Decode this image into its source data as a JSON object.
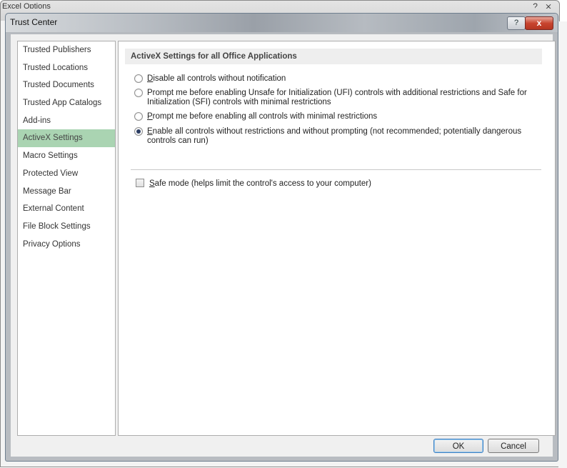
{
  "background_window": {
    "title": "Excel Options",
    "help_glyph": "?",
    "close_glyph": "⨯"
  },
  "dialog": {
    "title": "Trust Center",
    "help_glyph": "?",
    "close_glyph": "x"
  },
  "nav": {
    "items": [
      {
        "label": "Trusted Publishers"
      },
      {
        "label": "Trusted Locations"
      },
      {
        "label": "Trusted Documents"
      },
      {
        "label": "Trusted App Catalogs"
      },
      {
        "label": "Add-ins"
      },
      {
        "label": "ActiveX Settings",
        "active": true
      },
      {
        "label": "Macro Settings"
      },
      {
        "label": "Protected View"
      },
      {
        "label": "Message Bar"
      },
      {
        "label": "External Content"
      },
      {
        "label": "File Block Settings"
      },
      {
        "label": "Privacy Options"
      }
    ]
  },
  "main": {
    "section_title": "ActiveX Settings for all Office Applications",
    "options": [
      {
        "label_first": "D",
        "label_rest": "isable all controls without notification",
        "checked": false
      },
      {
        "label_first": "",
        "label_rest": "Prompt me before enabling Unsafe for Initialization (UFI) controls with additional restrictions and Safe for Initialization (SFI) controls with minimal restrictions",
        "checked": false
      },
      {
        "label_first": "P",
        "label_rest": "rompt me before enabling all controls with minimal restrictions",
        "checked": false
      },
      {
        "label_first": "E",
        "label_rest": "nable all controls without restrictions and without prompting (not recommended; potentially dangerous controls can run)",
        "checked": true
      }
    ],
    "safe_mode": {
      "label_first": "S",
      "label_rest": "afe mode (helps limit the control's access to your computer)",
      "checked": false
    }
  },
  "buttons": {
    "ok": "OK",
    "cancel": "Cancel"
  }
}
